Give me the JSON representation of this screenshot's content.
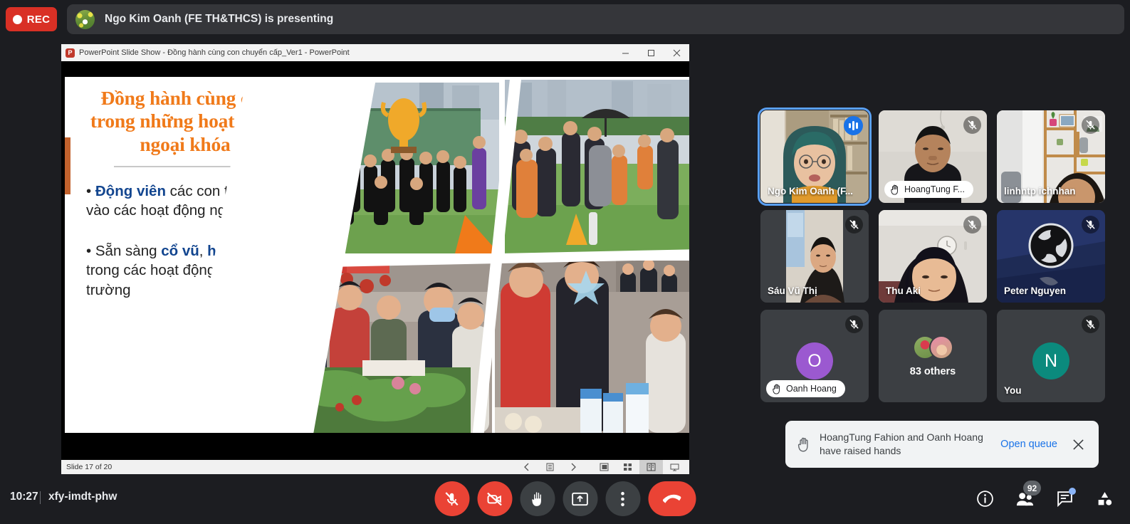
{
  "recording": {
    "label": "REC",
    "color": "#d93025"
  },
  "presenting": {
    "text": "Ngo Kim Oanh (FE TH&THCS) is presenting",
    "avatar": "person-avatar"
  },
  "powerpoint": {
    "title": "PowerPoint Slide Show  -  Đồng hành cùng con chuyển cấp_Ver1 - PowerPoint",
    "logo_letter": "P",
    "window_buttons": [
      "minimize-button",
      "maximize-button",
      "close-button"
    ],
    "status": "Slide 17 of 20",
    "status_buttons": [
      "previous-slide-button",
      "slide-menu-button",
      "next-slide-button",
      "normal-view-button",
      "slide-sorter-button",
      "reading-view-button",
      "slideshow-button"
    ]
  },
  "slide": {
    "heading": "Đồng hành cùng con trong những hoạt động ngoại khóa",
    "bullets": [
      {
        "lead": "Động viên",
        "rest": " các con tham gia vào các hoạt động ngoại khóa"
      },
      {
        "pre": "• Sẵn sàng ",
        "b1": "cổ vũ",
        "mid": ", ",
        "b2": "hỗ trợ",
        "rest": " con trong các hoạt động của lớp, trường"
      }
    ],
    "heading_color": "#f07a1a",
    "bold_color": "#12458f"
  },
  "participants": [
    {
      "name": "Ngo Kim Oanh (F...",
      "type": "video",
      "active_speaker": true,
      "muted": false,
      "hand_raised": false,
      "badge": "speaking-icon"
    },
    {
      "name": "HoangTung F...",
      "type": "video",
      "active_speaker": false,
      "muted": true,
      "hand_raised": true,
      "badge": "mic-off-icon"
    },
    {
      "name": "linhntp ichnhan",
      "type": "video",
      "active_speaker": false,
      "muted": true,
      "hand_raised": false,
      "badge": "mic-off-icon"
    },
    {
      "name": "Sáu Vũ Thị",
      "type": "video",
      "active_speaker": false,
      "muted": true,
      "hand_raised": false,
      "badge": "mic-off-icon"
    },
    {
      "name": "Thu Aki",
      "type": "video",
      "active_speaker": false,
      "muted": true,
      "hand_raised": false,
      "badge": "mic-off-icon"
    },
    {
      "name": "Peter Nguyen",
      "type": "logo",
      "active_speaker": false,
      "muted": true,
      "hand_raised": false,
      "badge": "mic-off-icon"
    },
    {
      "name": "Oanh Hoang",
      "type": "initial",
      "initial": "O",
      "avatar_color": "#9b59d0",
      "active_speaker": false,
      "muted": true,
      "hand_raised": true,
      "badge": "mic-off-icon"
    },
    {
      "name": "83 others",
      "type": "others",
      "active_speaker": false,
      "muted": false,
      "hand_raised": false
    },
    {
      "name": "You",
      "type": "initial",
      "initial": "N",
      "avatar_color": "#0b8a7d",
      "active_speaker": false,
      "muted": true,
      "hand_raised": false,
      "badge": "mic-off-icon"
    }
  ],
  "toast": {
    "message": "HoangTung Fahion and Oanh Hoang have raised hands",
    "action": "Open queue",
    "icon": "raised-hand-icon",
    "close": "close-icon"
  },
  "bottom": {
    "time": "10:27",
    "meeting_code": "xfy-imdt-phw",
    "controls": [
      {
        "name": "microphone-off-button",
        "state": "off"
      },
      {
        "name": "camera-off-button",
        "state": "off"
      },
      {
        "name": "raise-hand-button",
        "state": "normal"
      },
      {
        "name": "present-screen-button",
        "state": "normal"
      },
      {
        "name": "more-options-button",
        "state": "normal"
      },
      {
        "name": "end-call-button",
        "state": "danger"
      }
    ],
    "right_icons": [
      {
        "name": "meeting-details-icon",
        "badge": null
      },
      {
        "name": "people-icon",
        "badge": "92"
      },
      {
        "name": "chat-icon",
        "badge": "dot"
      },
      {
        "name": "activities-icon",
        "badge": null
      }
    ]
  }
}
